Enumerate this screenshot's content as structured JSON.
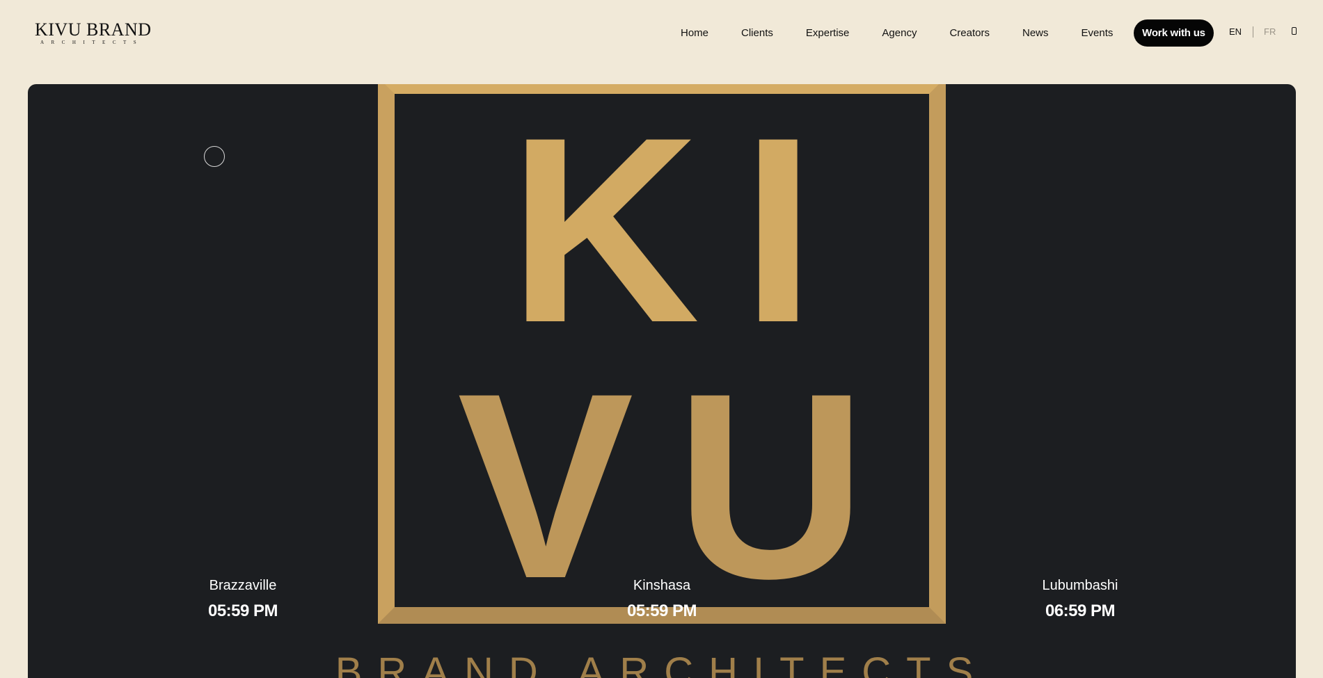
{
  "logo": {
    "main": "KIVU BRAND",
    "sub": "ARCHITECTS"
  },
  "nav": {
    "items": [
      "Home",
      "Clients",
      "Expertise",
      "Agency",
      "Creators",
      "News",
      "Events"
    ],
    "cta": "Work with us",
    "languages": {
      "active": "EN",
      "inactive": "FR"
    },
    "mobile_icon": "mobile-phone-icon"
  },
  "hero": {
    "line1": "KI",
    "line2": "VU",
    "tagline": "BRAND ARCHITECTS",
    "colors": {
      "background": "#1c1e21",
      "gold": "#c6a05e"
    },
    "clocks": [
      {
        "city": "Brazzaville",
        "time": "05:59 PM"
      },
      {
        "city": "Kinshasa",
        "time": "05:59 PM"
      },
      {
        "city": "Lubumbashi",
        "time": "06:59 PM"
      }
    ]
  }
}
